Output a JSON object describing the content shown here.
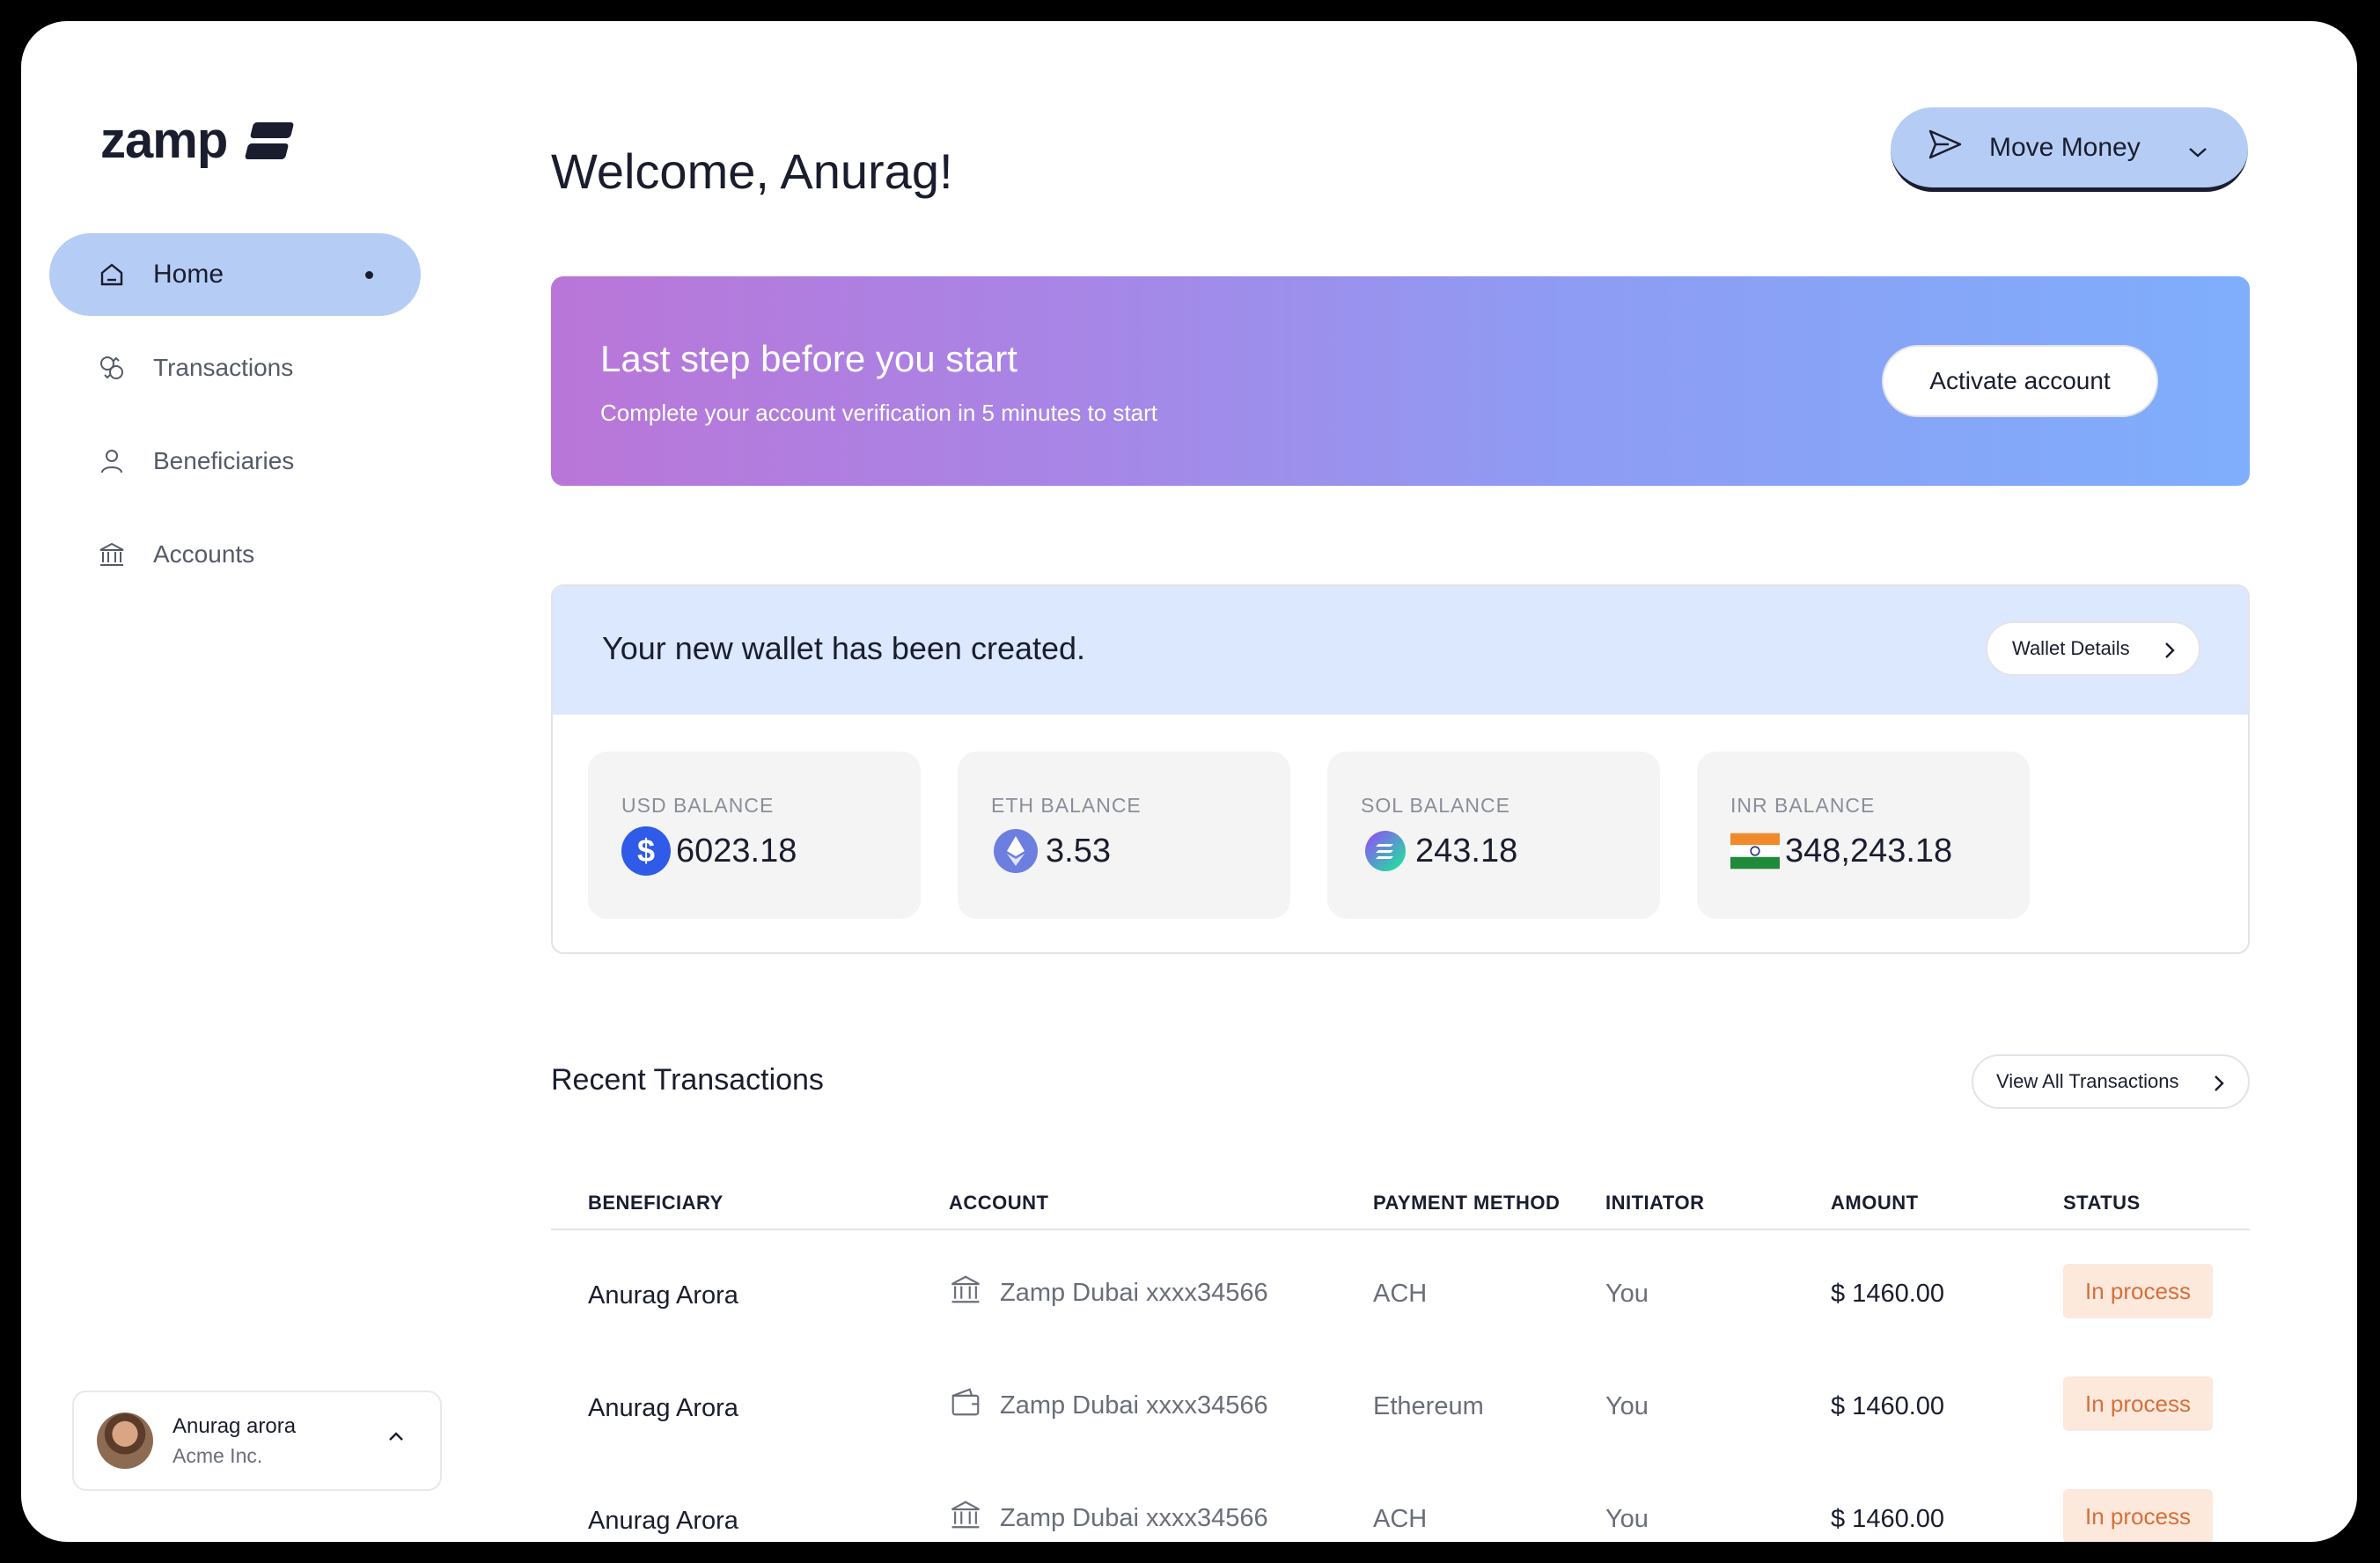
{
  "brand": {
    "name": "zamp"
  },
  "sidebar": {
    "items": [
      {
        "label": "Home",
        "icon": "home-icon",
        "active": true
      },
      {
        "label": "Transactions",
        "icon": "transactions-icon"
      },
      {
        "label": "Beneficiaries",
        "icon": "user-icon"
      },
      {
        "label": "Accounts",
        "icon": "bank-icon"
      }
    ]
  },
  "profile": {
    "name": "Anurag arora",
    "org": "Acme Inc."
  },
  "header": {
    "welcome": "Welcome, Anurag!",
    "move_money_label": "Move Money"
  },
  "banner": {
    "title": "Last step before you start",
    "subtitle": "Complete your account verification in 5 minutes to start",
    "button_label": "Activate account"
  },
  "wallet": {
    "title": "Your new wallet has been created.",
    "details_label": "Wallet Details",
    "balances": [
      {
        "label": "USD BALANCE",
        "value": "6023.18",
        "icon": "dollar-icon"
      },
      {
        "label": "ETH BALANCE",
        "value": "3.53",
        "icon": "ethereum-icon"
      },
      {
        "label": "SOL BALANCE",
        "value": "243.18",
        "icon": "solana-icon"
      },
      {
        "label": "INR BALANCE",
        "value": "348,243.18",
        "icon": "india-flag-icon"
      }
    ]
  },
  "transactions": {
    "title": "Recent Transactions",
    "view_all_label": "View All Transactions",
    "columns": [
      "BENEFICIARY",
      "ACCOUNT",
      "PAYMENT METHOD",
      "INITIATOR",
      "AMOUNT",
      "STATUS"
    ],
    "rows": [
      {
        "beneficiary": "Anurag Arora",
        "account": "Zamp Dubai xxxx34566",
        "account_icon": "bank-icon",
        "method": "ACH",
        "initiator": "You",
        "amount": "$ 1460.00",
        "status": "In process"
      },
      {
        "beneficiary": "Anurag Arora",
        "account": "Zamp Dubai xxxx34566",
        "account_icon": "wallet-icon",
        "method": "Ethereum",
        "initiator": "You",
        "amount": "$ 1460.00",
        "status": "In process"
      },
      {
        "beneficiary": "Anurag Arora",
        "account": "Zamp Dubai xxxx34566",
        "account_icon": "bank-icon",
        "method": "ACH",
        "initiator": "You",
        "amount": "$ 1460.00",
        "status": "In process"
      }
    ]
  },
  "colors": {
    "accent": "#b5cdf5",
    "status_bg": "#fde8dc",
    "status_text": "#d4703a"
  }
}
